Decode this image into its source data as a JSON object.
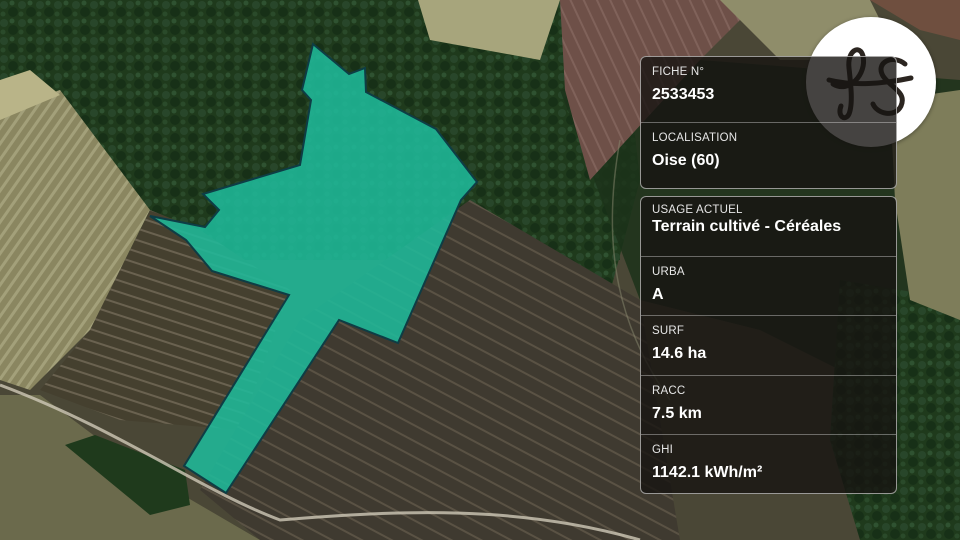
{
  "brand": {
    "logo_text": "fs",
    "logo_color": "#2b2520"
  },
  "parcel": {
    "fill_color": "#1fb99a",
    "stroke_color": "#0e3d45"
  },
  "card_identity": {
    "fiche_label": "FICHE N°",
    "fiche_value": "2533453",
    "localisation_label": "LOCALISATION",
    "localisation_value": "Oise (60)"
  },
  "card_details": {
    "usage_label": "USAGE ACTUEL",
    "usage_value": "Terrain cultivé - Céréales",
    "urba_label": "URBA",
    "urba_value": "A",
    "surf_label": "SURF",
    "surf_value": "14.6 ha",
    "racc_label": "RACC",
    "racc_value": "7.5 km",
    "ghi_label": "GHI",
    "ghi_value": "1142.1 kWh/m²"
  }
}
